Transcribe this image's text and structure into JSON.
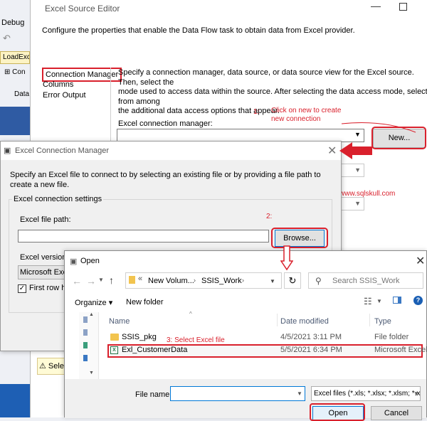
{
  "vs": {
    "debug": "Debug",
    "tab": "LoadExcel",
    "tree_item1": "Con",
    "tree_item2": "Data",
    "warning": "Selec"
  },
  "editor": {
    "title": "Excel Source Editor",
    "description": "Configure the properties that enable the Data Flow task to obtain data from Excel provider.",
    "nav": [
      "Connection Manager",
      "Columns",
      "Error Output"
    ],
    "spec_text": "Specify a connection manager, data source, or data source view for the Excel source. Then, select the\nmode used to access data within the source. After selecting the data access mode, select from among\nthe additional data access options that appear.",
    "conn_label": "Excel connection manager:",
    "new_label": "New...",
    "step1_num": "1:",
    "step1_text": "Click on new to create\nnew connection",
    "watermark": "www.sqlskull.com"
  },
  "ecm": {
    "title": "Excel Connection Manager",
    "description": "Specify an Excel file to connect to by selecting an existing file or by providing a file path to create a new file.",
    "group_label": "Excel connection settings",
    "path_label": "Excel file path:",
    "path_value": "",
    "browse_label": "Browse...",
    "step2": "2:",
    "version_label": "Excel version:",
    "version_value": "Microsoft Excel",
    "first_row_label": "First row has column names",
    "first_row_checked": "✓"
  },
  "open": {
    "title": "Open",
    "breadcrumb": [
      "New Volum...",
      "SSIS_Work"
    ],
    "search_placeholder": "Search SSIS_Work",
    "organize": "Organize ▾",
    "new_folder": "New folder",
    "columns": {
      "name": "Name",
      "date": "Date modified",
      "type": "Type"
    },
    "rows": [
      {
        "name": "SSIS_pkg",
        "date": "4/5/2021 3:11 PM",
        "type": "File folder"
      },
      {
        "name": "Exl_CustomerData",
        "date": "5/5/2021 6:34 PM",
        "type": "Microsoft Excel W"
      }
    ],
    "step3": "3: Select Excel file",
    "file_name_label": "File name:",
    "file_name_value": "",
    "file_type": "Excel files (*.xls; *.xlsx; *.xlsm; *.x",
    "open_label": "Open",
    "cancel_label": "Cancel"
  },
  "colors": {
    "annotation": "#d9202c",
    "accent": "#0078d7"
  }
}
